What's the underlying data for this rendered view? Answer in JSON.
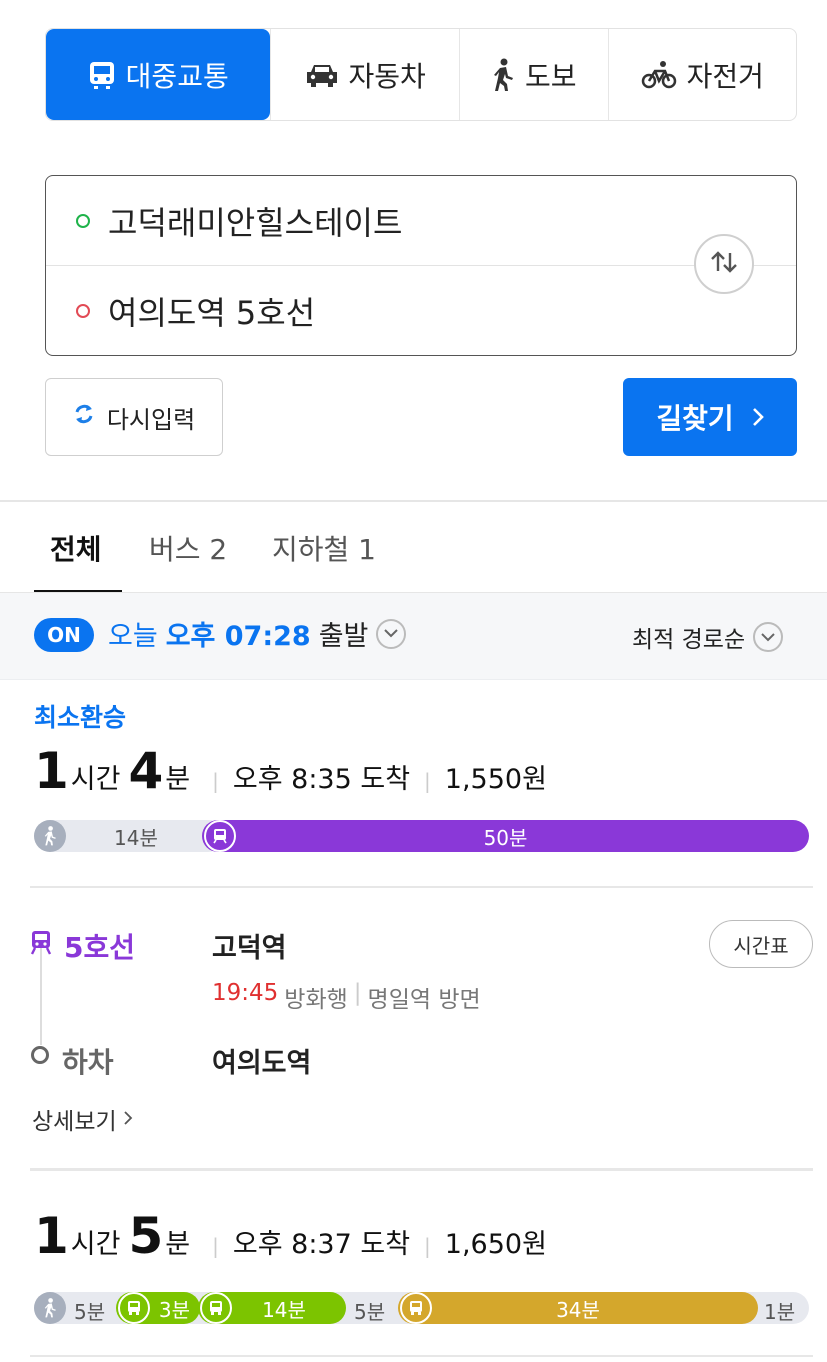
{
  "mode_tabs": [
    {
      "label": "대중교통",
      "icon": "bus-icon",
      "active": true
    },
    {
      "label": "자동차",
      "icon": "car-icon",
      "active": false
    },
    {
      "label": "도보",
      "icon": "walk-icon",
      "active": false
    },
    {
      "label": "자전거",
      "icon": "bicycle-icon",
      "active": false
    }
  ],
  "route": {
    "start": "고덕래미안힐스테이트",
    "end": "여의도역 5호선"
  },
  "buttons": {
    "reset": "다시입력",
    "search": "길찾기"
  },
  "filter_tabs": [
    "전체",
    "버스 2",
    "지하철 1"
  ],
  "departure": {
    "on_badge": "ON",
    "day": "오늘",
    "time": "오후 07:28",
    "suffix": "출발",
    "sort": "최적 경로순"
  },
  "results": [
    {
      "badge": "최소환승",
      "hours": "1",
      "hours_unit": "시간",
      "minutes": "4",
      "minutes_unit": "분",
      "arrival": "오후 8:35 도착",
      "fare": "1,550원",
      "segments": [
        {
          "type": "walk",
          "label": "14분"
        },
        {
          "type": "subway",
          "label": "50분"
        }
      ],
      "steps": {
        "line": "5호선",
        "board_station": "고덕역",
        "depart_time": "19:45",
        "direction": "방화행",
        "direction_side": "명일역 방면",
        "getoff_label": "하차",
        "getoff_station": "여의도역",
        "timetable": "시간표",
        "detail": "상세보기"
      }
    },
    {
      "hours": "1",
      "hours_unit": "시간",
      "minutes": "5",
      "minutes_unit": "분",
      "arrival": "오후 8:37 도착",
      "fare": "1,650원",
      "segments": [
        {
          "type": "walk",
          "label": "5분"
        },
        {
          "type": "bus",
          "label": "3분"
        },
        {
          "type": "bus",
          "label": "14분"
        },
        {
          "type": "walk",
          "label": "5분"
        },
        {
          "type": "bus-express",
          "label": "34분"
        },
        {
          "type": "walk",
          "label": "1분"
        }
      ]
    }
  ],
  "colors": {
    "primary": "#0a74f0",
    "subway_line5": "#8a38d8",
    "bus_green": "#7cc400",
    "bus_yellow": "#d4a72c",
    "walk_gray": "#e7e9ef"
  }
}
